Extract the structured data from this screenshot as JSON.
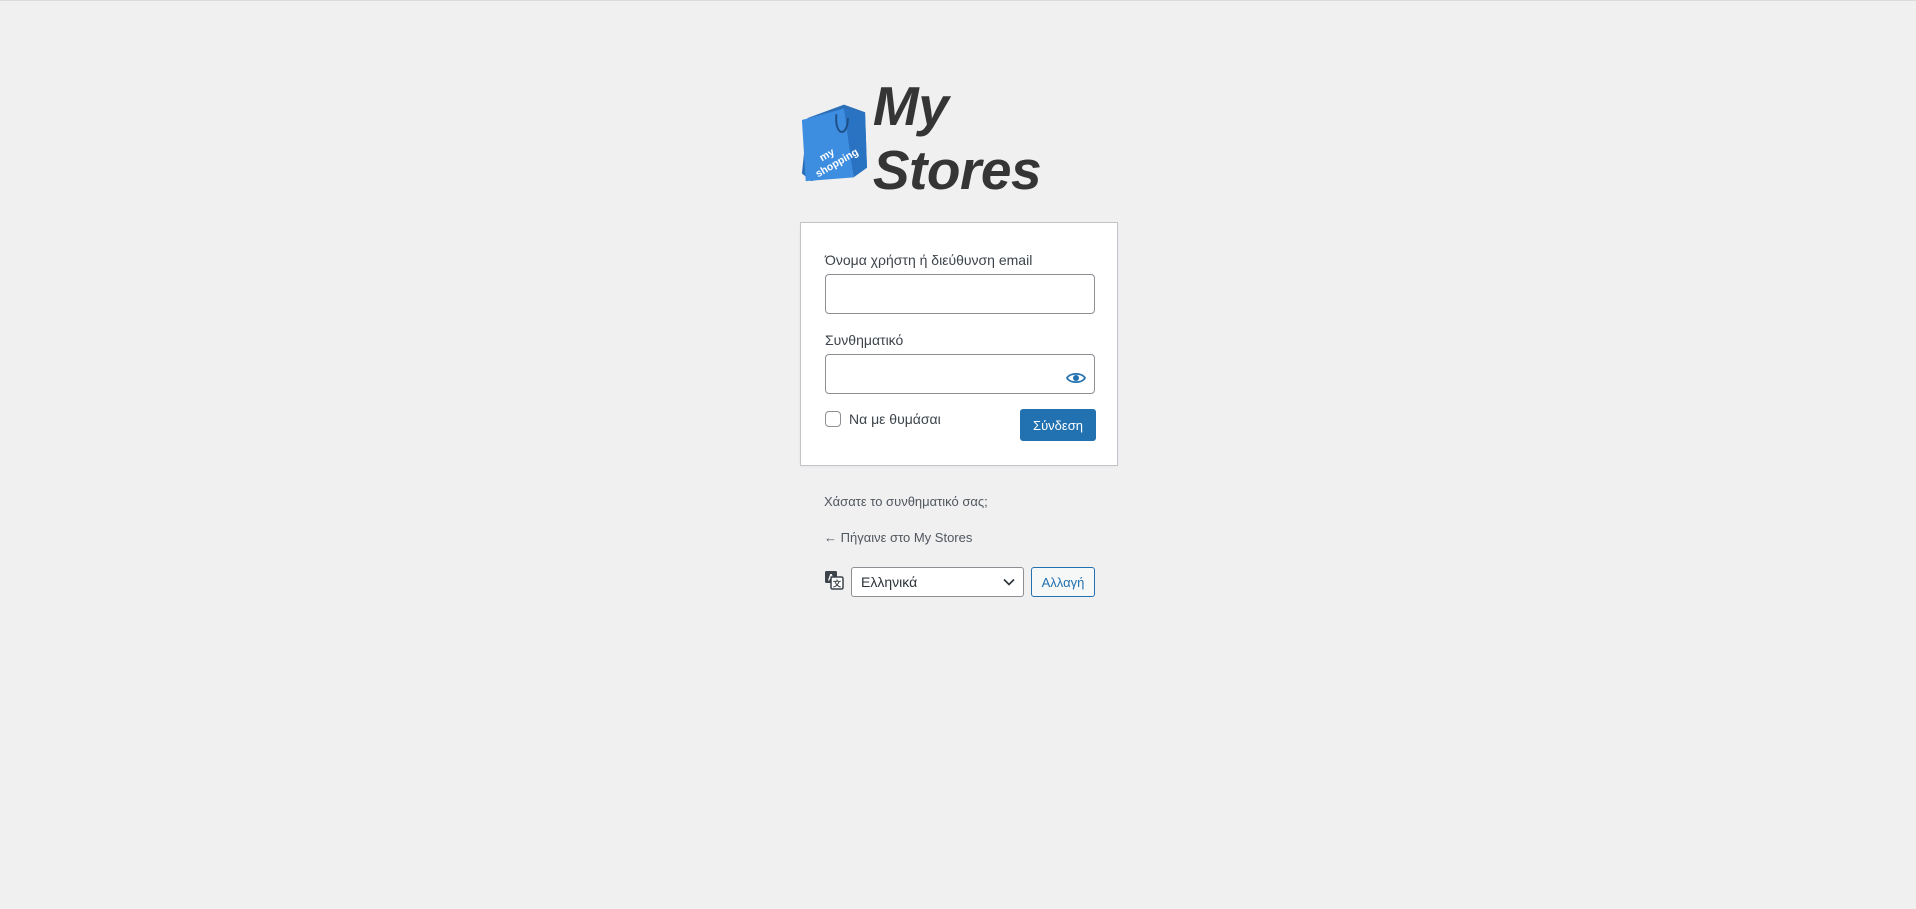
{
  "site": {
    "name": "My Stores",
    "bag_lettering": "my shopping"
  },
  "form": {
    "username_label": "Όνομα χρήστη ή διεύθυνση email",
    "username_value": "",
    "password_label": "Συνθηματικό",
    "password_value": "",
    "remember_label": "Να με θυμάσαι",
    "remember_checked": false,
    "submit_label": "Σύνδεση"
  },
  "links": {
    "lost_password": "Χάσατε το συνθηματικό σας;",
    "back_to_site": "← Πήγαινε στο My Stores"
  },
  "language": {
    "selected": "Ελληνικά",
    "change_label": "Αλλαγή"
  },
  "colors": {
    "accent": "#2271b1",
    "background": "#f0f0f1",
    "logo_bag": "#3d8ee0"
  },
  "icons": {
    "show_password": "eye-icon",
    "language": "translation-icon",
    "select": "chevron-down-icon"
  }
}
